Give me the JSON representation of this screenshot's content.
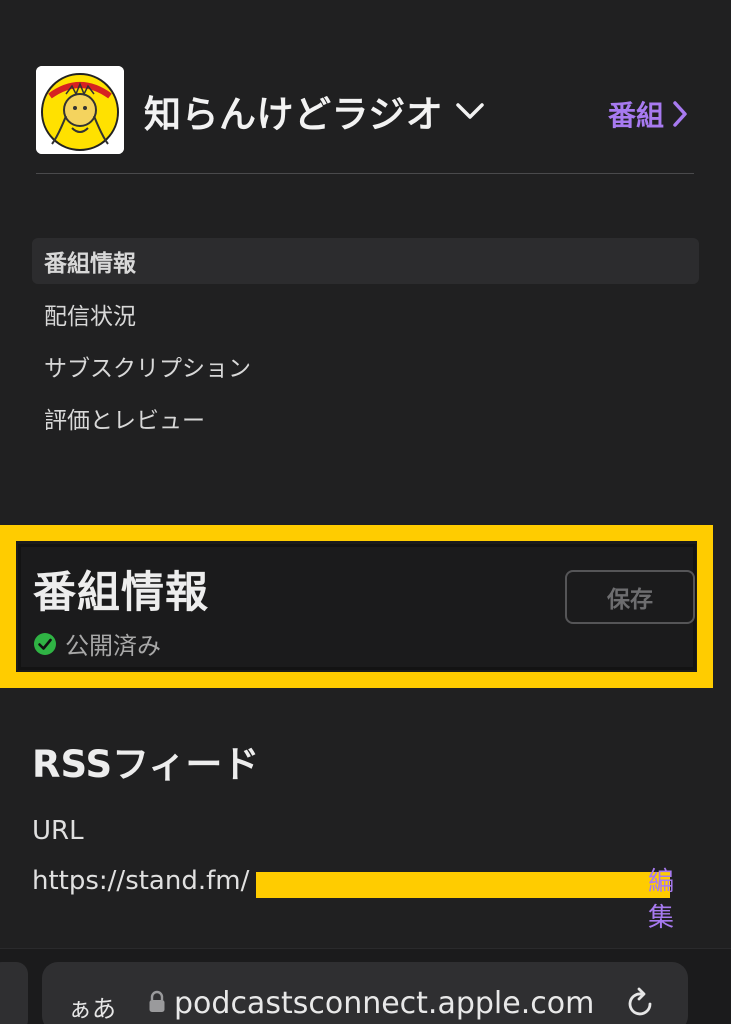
{
  "header": {
    "show_title": "知らんけどラジオ",
    "shows_link": "番組"
  },
  "nav": {
    "items": [
      {
        "label": "番組情報",
        "active": true
      },
      {
        "label": "配信状況",
        "active": false
      },
      {
        "label": "サブスクリプション",
        "active": false
      },
      {
        "label": "評価とレビュー",
        "active": false
      }
    ]
  },
  "section": {
    "title": "番組情報",
    "status": "公開済み",
    "save_label": "保存"
  },
  "rss": {
    "title": "RSSフィード",
    "url_label": "URL",
    "url_value": "https://stand.fm/",
    "edit_label": "編集"
  },
  "browser": {
    "aa_label": "ぁあ",
    "address": "podcastsconnect.apple.com"
  },
  "colors": {
    "accent": "#a77af0",
    "highlight": "#ffcc00",
    "status_ok": "#2fb344",
    "background": "#202021"
  },
  "icons": {
    "title_chevron": "chevron-down-icon",
    "shows_chevron": "chevron-right-icon",
    "status": "check-circle-icon",
    "lock": "lock-icon",
    "reload": "reload-icon"
  }
}
